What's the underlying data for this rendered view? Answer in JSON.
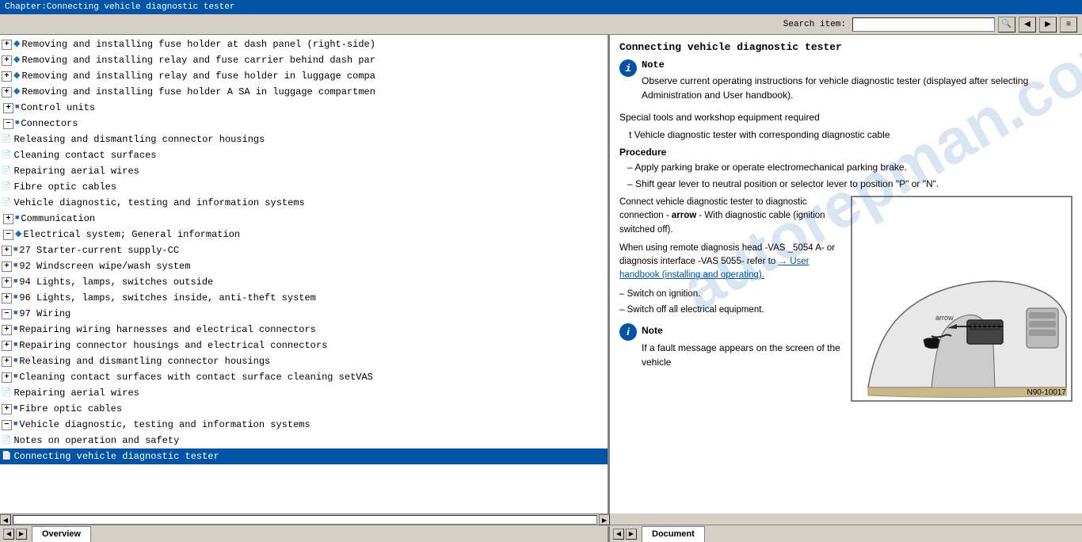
{
  "titleBar": {
    "text": "Chapter:Connecting vehicle diagnostic tester"
  },
  "toolbar": {
    "searchLabel": "Search item:",
    "searchPlaceholder": ""
  },
  "leftPanel": {
    "items": [
      {
        "id": "fuse-holder-dash",
        "level": 1,
        "type": "diamond-expand",
        "text": "Removing and installing fuse holder at dash panel (right-side)"
      },
      {
        "id": "relay-fuse-carrier",
        "level": 1,
        "type": "diamond-expand",
        "text": "Removing and installing relay and fuse carrier behind dash par"
      },
      {
        "id": "relay-fuse-holder-luggage",
        "level": 1,
        "type": "diamond-expand",
        "text": "Removing and installing relay and fuse holder in luggage compa"
      },
      {
        "id": "fuse-holder-SA",
        "level": 1,
        "type": "diamond-expand",
        "text": "Removing and installing fuse holder A SA in luggage compartmen"
      },
      {
        "id": "control-units",
        "level": 0,
        "type": "square-expand",
        "text": "Control units"
      },
      {
        "id": "connectors",
        "level": 0,
        "type": "square-expand-open",
        "text": "Connectors"
      },
      {
        "id": "releasing-connector",
        "level": 1,
        "type": "doc",
        "text": "Releasing and dismantling connector housings"
      },
      {
        "id": "cleaning-contact",
        "level": 1,
        "type": "doc",
        "text": "Cleaning contact surfaces"
      },
      {
        "id": "repairing-aerial",
        "level": 1,
        "type": "doc",
        "text": "Repairing aerial wires"
      },
      {
        "id": "fibre-optic",
        "level": 1,
        "type": "doc",
        "text": "Fibre optic cables"
      },
      {
        "id": "vehicle-diagnostic",
        "level": 1,
        "type": "doc",
        "text": "Vehicle diagnostic, testing and information systems"
      },
      {
        "id": "communication",
        "level": 0,
        "type": "square-expand",
        "text": "Communication"
      },
      {
        "id": "electrical-general",
        "level": 0,
        "type": "diamond-expand-open",
        "text": "Electrical system; General information"
      },
      {
        "id": "27-starter",
        "level": 1,
        "type": "square-expand",
        "text": "27 Starter-current supply-CC"
      },
      {
        "id": "92-windscreen",
        "level": 1,
        "type": "square-expand",
        "text": "92 Windscreen wipe/wash system"
      },
      {
        "id": "94-lights",
        "level": 1,
        "type": "square-expand",
        "text": "94 Lights, lamps, switches outside"
      },
      {
        "id": "96-lights",
        "level": 1,
        "type": "square-expand",
        "text": "96 Lights, lamps, switches inside, anti-theft system"
      },
      {
        "id": "97-wiring",
        "level": 1,
        "type": "square-expand-open",
        "text": "97 Wiring"
      },
      {
        "id": "repairing-harnesses",
        "level": 2,
        "type": "square-expand",
        "text": "Repairing wiring harnesses and electrical connectors"
      },
      {
        "id": "repairing-connector-h",
        "level": 2,
        "type": "square-expand",
        "text": "Repairing connector housings and electrical connectors"
      },
      {
        "id": "releasing-dismantling",
        "level": 2,
        "type": "square-expand",
        "text": "Releasing and dismantling connector housings"
      },
      {
        "id": "cleaning-contact-s",
        "level": 2,
        "type": "square-expand",
        "text": "Cleaning contact surfaces with contact surface cleaning setVAS"
      },
      {
        "id": "repairing-aerial-2",
        "level": 2,
        "type": "doc",
        "text": "Repairing aerial wires"
      },
      {
        "id": "fibre-optic-2",
        "level": 2,
        "type": "square-expand",
        "text": "Fibre optic cables"
      },
      {
        "id": "vehicle-diag-systems",
        "level": 2,
        "type": "square-expand-open",
        "text": "Vehicle diagnostic, testing and information systems"
      },
      {
        "id": "notes-operation",
        "level": 3,
        "type": "doc",
        "text": "Notes on operation and safety"
      },
      {
        "id": "connecting-tester",
        "level": 3,
        "type": "doc-active",
        "text": "Connecting vehicle diagnostic tester"
      }
    ]
  },
  "rightPanel": {
    "title": "Connecting vehicle diagnostic tester",
    "noteLabel": "Note",
    "noteText": "Observe current operating instructions for vehicle diagnostic tester (displayed after selecting Administration and User handbook).",
    "specialToolsHeader": "Special tools and workshop equipment required",
    "specialToolsItem": "t  Vehicle diagnostic tester with corresponding diagnostic cable",
    "procedureHeader": "Procedure",
    "steps": [
      "Apply parking brake or operate electromechanical parking brake.",
      "Shift gear lever to neutral position or selector lever to position \"P\" or \"N\"."
    ],
    "connectText": "Connect vehicle diagnostic tester to diagnostic connection - arrow- with diagnostic cable (ignition switched off).",
    "remoteText": "When using remote diagnosis head -VAS _5054 A- or diagnosis interface -VAS 5055- refer to",
    "linkText": "→ User handbook (installing and operating).",
    "switchOnText": "–  Switch on ignition.",
    "switchOffText": "–  Switch off all electrical equipment.",
    "note2Label": "Note",
    "note2Text": "If a fault message appears on the screen of the vehicle",
    "diagramLabel": "N90-10017",
    "watermarkText": "autorepman.com.tr"
  },
  "statusBar": {
    "leftTab": "Overview",
    "rightTab": "Document"
  }
}
